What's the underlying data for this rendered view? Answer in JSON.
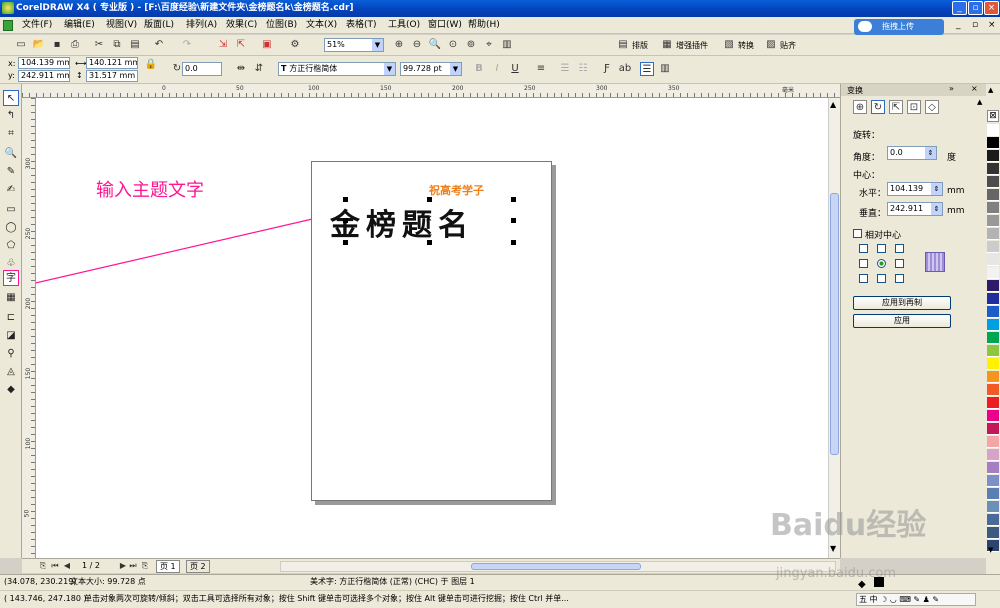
{
  "title_bar": {
    "title": "CorelDRAW X4 ( 专业版 ) - [F:\\百度经验\\新建文件夹\\金榜题名k\\金榜题名.cdr]",
    "upload_label": "拖拽上传"
  },
  "menu": [
    "文件(F)",
    "编辑(E)",
    "视图(V)",
    "版面(L)",
    "排列(A)",
    "效果(C)",
    "位图(B)",
    "文本(X)",
    "表格(T)",
    "工具(O)",
    "窗口(W)",
    "帮助(H)"
  ],
  "std_toolbar": {
    "zoom": "51%",
    "plugins": [
      "排版",
      "增强插件",
      "转换",
      "贴齐"
    ]
  },
  "prop_bar": {
    "x": "104.139 mm",
    "y": "242.911 mm",
    "width": "140.121 mm",
    "height": "31.517 mm",
    "rotation": "0.0",
    "font_name": "方正行楷简体",
    "font_size": "99.728 pt"
  },
  "ruler": {
    "h_ticks": [
      "0",
      "50",
      "100",
      "150",
      "200",
      "250",
      "300",
      "350"
    ],
    "v_ticks": [
      "300",
      "250",
      "200",
      "150",
      "100",
      "50"
    ],
    "unit": "毫米"
  },
  "canvas": {
    "annotation": "输入主题文字",
    "subtitle": "祝高考学子",
    "headline": "金榜题名"
  },
  "page_nav": {
    "counter": "1 / 2",
    "tabs": [
      "页 1",
      "页 2"
    ]
  },
  "docker": {
    "title": "变换",
    "rotate_label": "旋转：",
    "angle_label": "角度：",
    "angle_value": "0.0",
    "angle_unit": "度",
    "center_label": "中心：",
    "h_label": "水平：",
    "h_value": "104.139",
    "v_label": "垂直：",
    "v_value": "242.911",
    "unit": "mm",
    "relative_center": "相对中心",
    "apply_dup": "应用到再制",
    "apply": "应用"
  },
  "palette_colors": [
    "#ffffff",
    "#000000",
    "#1a1a1a",
    "#333333",
    "#4d4d4d",
    "#666666",
    "#808080",
    "#999999",
    "#b3b3b3",
    "#cccccc",
    "#e6e6e6",
    "#f2f2f2",
    "#2e1a6b",
    "#1f2e9e",
    "#1c5ec9",
    "#009fe3",
    "#00a651",
    "#8dc63f",
    "#fff200",
    "#f7941d",
    "#f15a24",
    "#ed1c24",
    "#ec008c",
    "#c2185b",
    "#f4a6a6",
    "#d9a3c9",
    "#a57fc1",
    "#7c8fc8",
    "#5a7fb5",
    "#6c8fb8",
    "#4a6a9a",
    "#3d5a80",
    "#2b4570"
  ],
  "status": {
    "coords": "(34.078, 230.219)",
    "text_size": "文本大小: 99.728 点",
    "object_info": "美术字: 方正行楷简体 (正常) (CHC) 于 图层 1",
    "coords2": "( 143.746, 247.180 )",
    "hint": "单击对象两次可旋转/倾斜；双击工具可选择所有对象；按住 Shift 键单击可选择多个对象；按住 Alt 键单击可进行挖掘；按住 Ctrl 并单..."
  },
  "watermark": {
    "brand": "Baidu经验",
    "url": "jingyan.baidu.com"
  },
  "colors": {
    "annotation": "#ff1493",
    "subtitle": "#f07f19",
    "title_bar": "#0a5fd8"
  }
}
